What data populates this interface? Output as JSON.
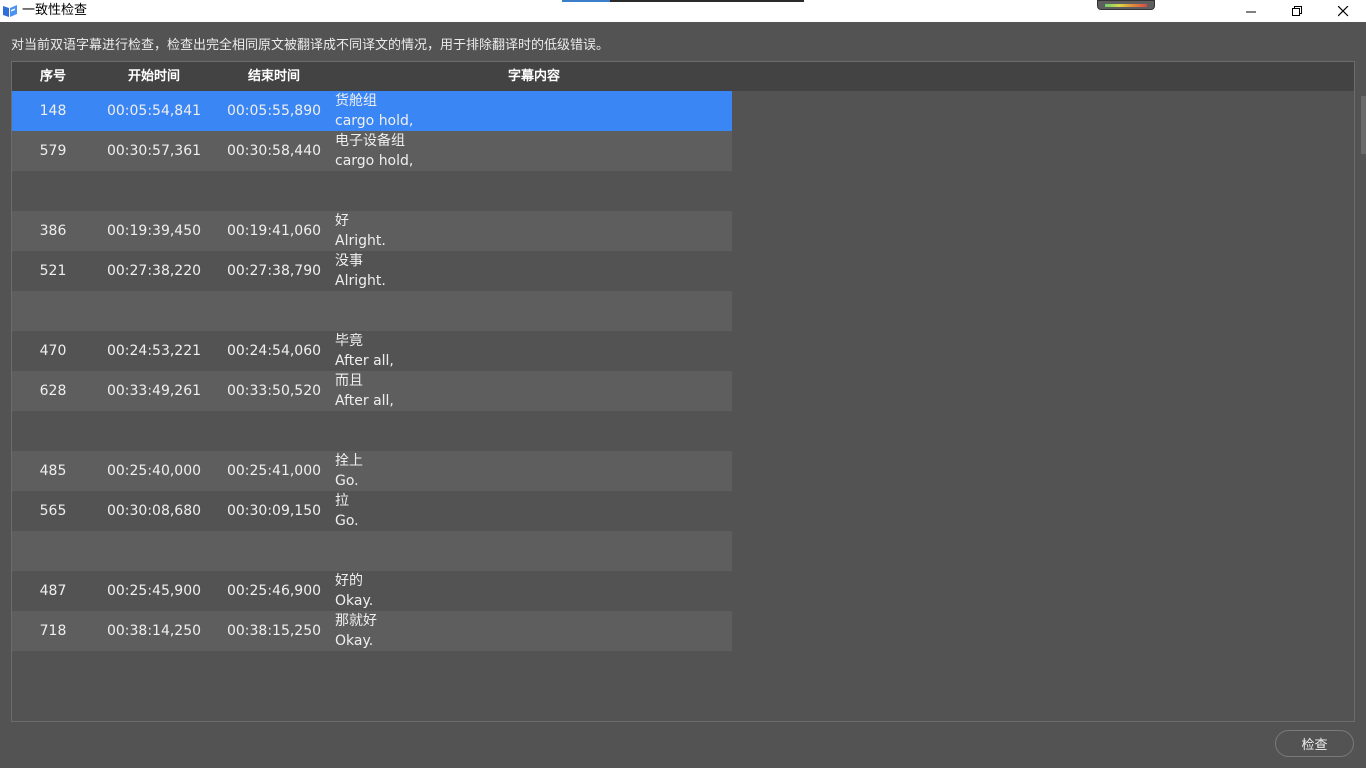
{
  "window": {
    "title": "一致性检查",
    "controls": {
      "minimize": "—",
      "maximize": "❐",
      "close": "✕"
    }
  },
  "description": "对当前双语字幕进行检查，检查出完全相同原文被翻译成不同译文的情况，用于排除翻译时的低级错误。",
  "table": {
    "columns": [
      "序号",
      "开始时间",
      "结束时间",
      "字幕内容"
    ],
    "rows": [
      {
        "index": "148",
        "start": "00:05:54,841",
        "end": "00:05:55,890",
        "line1": "货舱组",
        "line2": "cargo hold,",
        "selected": true
      },
      {
        "index": "579",
        "start": "00:30:57,361",
        "end": "00:30:58,440",
        "line1": "电子设备组",
        "line2": "cargo hold,"
      },
      {
        "index": "",
        "start": "",
        "end": "",
        "line1": "",
        "line2": ""
      },
      {
        "index": "386",
        "start": "00:19:39,450",
        "end": "00:19:41,060",
        "line1": "好",
        "line2": "Alright."
      },
      {
        "index": "521",
        "start": "00:27:38,220",
        "end": "00:27:38,790",
        "line1": "没事",
        "line2": "Alright."
      },
      {
        "index": "",
        "start": "",
        "end": "",
        "line1": "",
        "line2": ""
      },
      {
        "index": "470",
        "start": "00:24:53,221",
        "end": "00:24:54,060",
        "line1": "毕竟",
        "line2": "After all,"
      },
      {
        "index": "628",
        "start": "00:33:49,261",
        "end": "00:33:50,520",
        "line1": "而且",
        "line2": "After all,"
      },
      {
        "index": "",
        "start": "",
        "end": "",
        "line1": "",
        "line2": ""
      },
      {
        "index": "485",
        "start": "00:25:40,000",
        "end": "00:25:41,000",
        "line1": "拴上",
        "line2": "Go."
      },
      {
        "index": "565",
        "start": "00:30:08,680",
        "end": "00:30:09,150",
        "line1": "拉",
        "line2": "Go."
      },
      {
        "index": "",
        "start": "",
        "end": "",
        "line1": "",
        "line2": ""
      },
      {
        "index": "487",
        "start": "00:25:45,900",
        "end": "00:25:46,900",
        "line1": "好的",
        "line2": "Okay."
      },
      {
        "index": "718",
        "start": "00:38:14,250",
        "end": "00:38:15,250",
        "line1": "那就好",
        "line2": "Okay."
      }
    ]
  },
  "actions": {
    "check_label": "检查"
  },
  "colors": {
    "selection": "#3a86f5",
    "background": "#535353",
    "header": "#434343",
    "alt_row": "#5e5e5e"
  }
}
